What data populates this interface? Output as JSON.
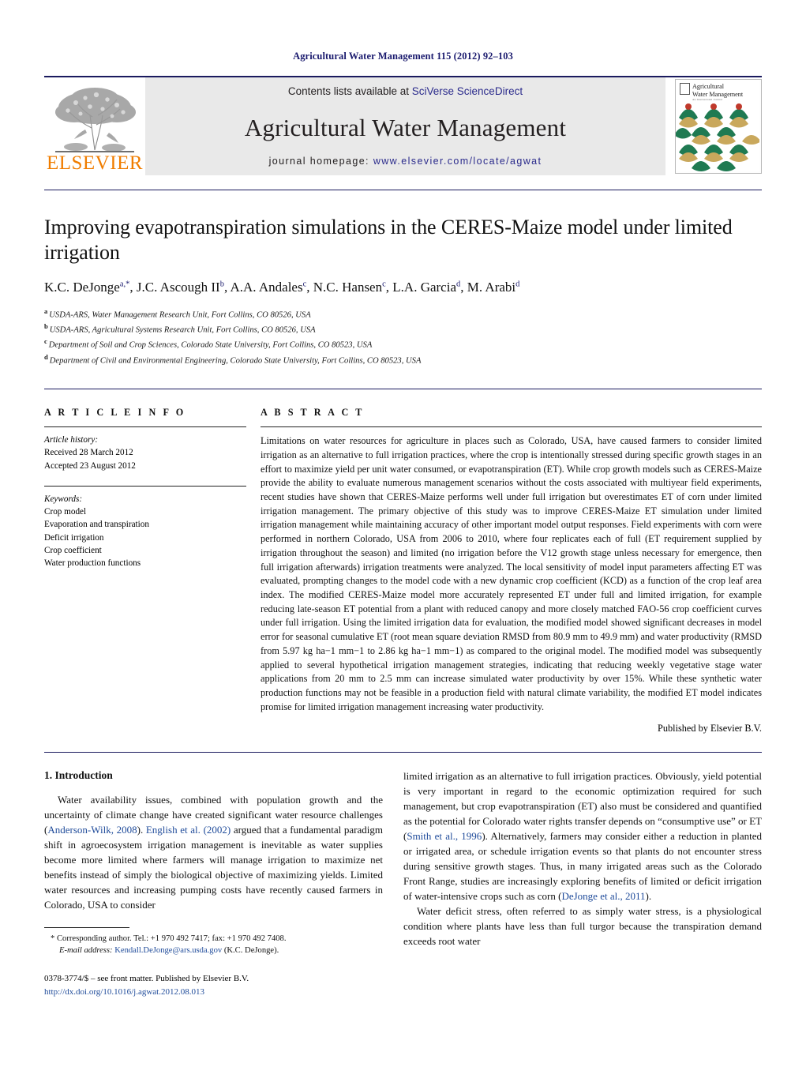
{
  "running_head": "Agricultural Water Management 115 (2012) 92–103",
  "masthead": {
    "publisher_logo_text": "ELSEVIER",
    "contents_prefix": "Contents lists available at ",
    "contents_link": "SciVerse ScienceDirect",
    "journal_title": "Agricultural Water Management",
    "homepage_prefix": "journal homepage: ",
    "homepage_url": "www.elsevier.com/locate/agwat",
    "cover_title_line1": "Agricultural",
    "cover_title_line2": "Water Management",
    "cover_subtitle": "An International Journal",
    "accent_link_color": "#2b2b8c",
    "cover_green": "#1f7a52",
    "cover_tan": "#c9a85c",
    "cover_red": "#c0392b"
  },
  "article": {
    "title": "Improving evapotranspiration simulations in the CERES-Maize model under limited irrigation",
    "authors": [
      {
        "name": "K.C. DeJonge",
        "sup": "a,*"
      },
      {
        "name": "J.C. Ascough II",
        "sup": "b"
      },
      {
        "name": "A.A. Andales",
        "sup": "c"
      },
      {
        "name": "N.C. Hansen",
        "sup": "c"
      },
      {
        "name": "L.A. Garcia",
        "sup": "d"
      },
      {
        "name": "M. Arabi",
        "sup": "d"
      }
    ],
    "affiliations": [
      {
        "marker": "a",
        "text": "USDA-ARS, Water Management Research Unit, Fort Collins, CO 80526, USA"
      },
      {
        "marker": "b",
        "text": "USDA-ARS, Agricultural Systems Research Unit, Fort Collins, CO 80526, USA"
      },
      {
        "marker": "c",
        "text": "Department of Soil and Crop Sciences, Colorado State University, Fort Collins, CO 80523, USA"
      },
      {
        "marker": "d",
        "text": "Department of Civil and Environmental Engineering, Colorado State University, Fort Collins, CO 80523, USA"
      }
    ]
  },
  "article_info": {
    "heading": "A R T I C L E    I N F O",
    "history_label": "Article history:",
    "received": "Received 28 March 2012",
    "accepted": "Accepted 23 August 2012",
    "keywords_label": "Keywords:",
    "keywords": [
      "Crop model",
      "Evaporation and transpiration",
      "Deficit irrigation",
      "Crop coefficient",
      "Water production functions"
    ]
  },
  "abstract": {
    "heading": "A B S T R A C T",
    "text": "Limitations on water resources for agriculture in places such as Colorado, USA, have caused farmers to consider limited irrigation as an alternative to full irrigation practices, where the crop is intentionally stressed during specific growth stages in an effort to maximize yield per unit water consumed, or evapotranspiration (ET). While crop growth models such as CERES-Maize provide the ability to evaluate numerous management scenarios without the costs associated with multiyear field experiments, recent studies have shown that CERES-Maize performs well under full irrigation but overestimates ET of corn under limited irrigation management. The primary objective of this study was to improve CERES-Maize ET simulation under limited irrigation management while maintaining accuracy of other important model output responses. Field experiments with corn were performed in northern Colorado, USA from 2006 to 2010, where four replicates each of full (ET requirement supplied by irrigation throughout the season) and limited (no irrigation before the V12 growth stage unless necessary for emergence, then full irrigation afterwards) irrigation treatments were analyzed. The local sensitivity of model input parameters affecting ET was evaluated, prompting changes to the model code with a new dynamic crop coefficient (KCD) as a function of the crop leaf area index. The modified CERES-Maize model more accurately represented ET under full and limited irrigation, for example reducing late-season ET potential from a plant with reduced canopy and more closely matched FAO-56 crop coefficient curves under full irrigation. Using the limited irrigation data for evaluation, the modified model showed significant decreases in model error for seasonal cumulative ET (root mean square deviation RMSD from 80.9 mm to 49.9 mm) and water productivity (RMSD from 5.97 kg ha−1 mm−1 to 2.86 kg ha−1 mm−1) as compared to the original model. The modified model was subsequently applied to several hypothetical irrigation management strategies, indicating that reducing weekly vegetative stage water applications from 20 mm to 2.5 mm can increase simulated water productivity by over 15%. While these synthetic water production functions may not be feasible in a production field with natural climate variability, the modified ET model indicates promise for limited irrigation management increasing water productivity.",
    "published_by": "Published by Elsevier B.V."
  },
  "introduction": {
    "section_number_title": "1.  Introduction",
    "left_para1": "Water availability issues, combined with population growth and the uncertainty of climate change have created significant water resource challenges (Anderson-Wilk, 2008). English et al. (2002) argued that a fundamental paradigm shift in agroecosystem irrigation management is inevitable as water supplies become more limited where farmers will manage irrigation to maximize net benefits instead of simply the biological objective of maximizing yields. Limited water resources and increasing pumping costs have recently caused farmers in Colorado, USA to consider",
    "right_para1": "limited irrigation as an alternative to full irrigation practices. Obviously, yield potential is very important in regard to the economic optimization required for such management, but crop evapotranspiration (ET) also must be considered and quantified as the potential for Colorado water rights transfer depends on “consumptive use” or ET (Smith et al., 1996). Alternatively, farmers may consider either a reduction in planted or irrigated area, or schedule irrigation events so that plants do not encounter stress during sensitive growth stages. Thus, in many irrigated areas such as the Colorado Front Range, studies are increasingly exploring benefits of limited or deficit irrigation of water-intensive crops such as corn (DeJonge et al., 2011).",
    "right_para2": "Water deficit stress, often referred to as simply water stress, is a physiological condition where plants have less than full turgor because the transpiration demand exceeds root water"
  },
  "footer": {
    "corresponding_marker": "*",
    "corresponding_text": "Corresponding author. Tel.: +1 970 492 7417; fax: +1 970 492 7408.",
    "email_label": "E-mail address:",
    "email": "Kendall.DeJonge@ars.usda.gov",
    "email_owner": "(K.C. DeJonge).",
    "issn_line": "0378-3774/$ – see front matter. Published by Elsevier B.V.",
    "doi_line": "http://dx.doi.org/10.1016/j.agwat.2012.08.013"
  }
}
